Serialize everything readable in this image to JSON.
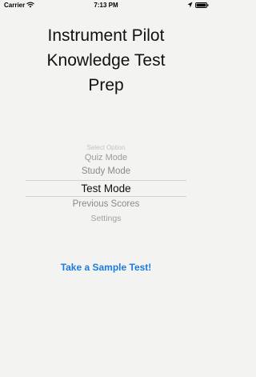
{
  "status_bar": {
    "carrier": "Carrier",
    "time": "7:13 PM",
    "icons": [
      "wifi-icon",
      "location-arrow-icon",
      "battery-icon"
    ]
  },
  "title": {
    "line1": "Instrument Pilot",
    "line2": "Knowledge Test",
    "line3": "Prep"
  },
  "picker": {
    "header": "Select Option",
    "options": [
      "Quiz Mode",
      "Study Mode",
      "Test Mode",
      "Previous Scores",
      "Settings"
    ],
    "selected": "Test Mode"
  },
  "sample_test_link": "Take a Sample Test!",
  "colors": {
    "background": "#f3f3f1",
    "link": "#1a7be0",
    "text": "#111111"
  }
}
